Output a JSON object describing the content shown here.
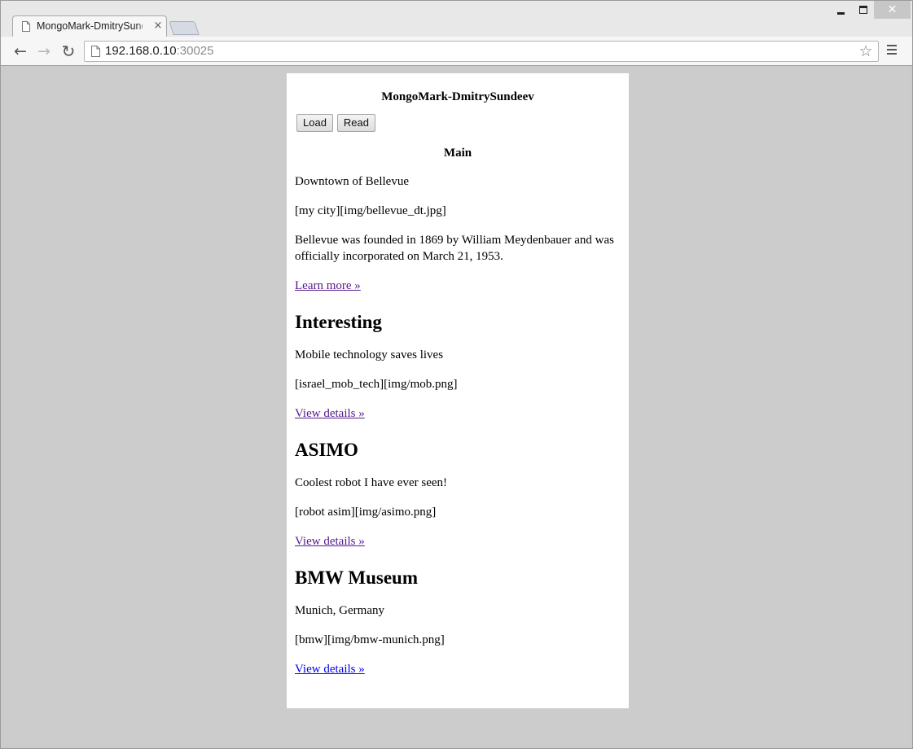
{
  "browser": {
    "tab_title": "MongoMark-DmitrySundeev",
    "tab_close": "×",
    "url_host": "192.168.0.10",
    "url_port": ":30025",
    "back_glyph": "←",
    "forward_glyph": "→",
    "reload_glyph": "↻",
    "star_glyph": "☆",
    "close_glyph": "✕"
  },
  "page": {
    "site_title": "MongoMark-DmitrySundeev",
    "buttons": {
      "load": "Load",
      "read": "Read"
    },
    "main": {
      "heading": "Main",
      "subtitle": "Downtown of Bellevue",
      "image_ref": "[my city][img/bellevue_dt.jpg]",
      "body": "Bellevue was founded in 1869 by William Meydenbauer and was officially incorporated on March 21, 1953.",
      "link": "Learn more »"
    },
    "articles": [
      {
        "title": "Interesting",
        "subtitle": "Mobile technology saves lives",
        "image_ref": "[israel_mob_tech][img/mob.png]",
        "link": "View details »"
      },
      {
        "title": "ASIMO",
        "subtitle": "Coolest robot I have ever seen!",
        "image_ref": "[robot asim][img/asimo.png]",
        "link": "View details »"
      },
      {
        "title": "BMW Museum",
        "subtitle": "Munich, Germany",
        "image_ref": "[bmw][img/bmw-munich.png]",
        "link": "View details »"
      }
    ]
  },
  "colors": {
    "visited_link": "#551a8b",
    "unvisited_link": "#0000ee",
    "viewport_bg": "#cccccc"
  }
}
